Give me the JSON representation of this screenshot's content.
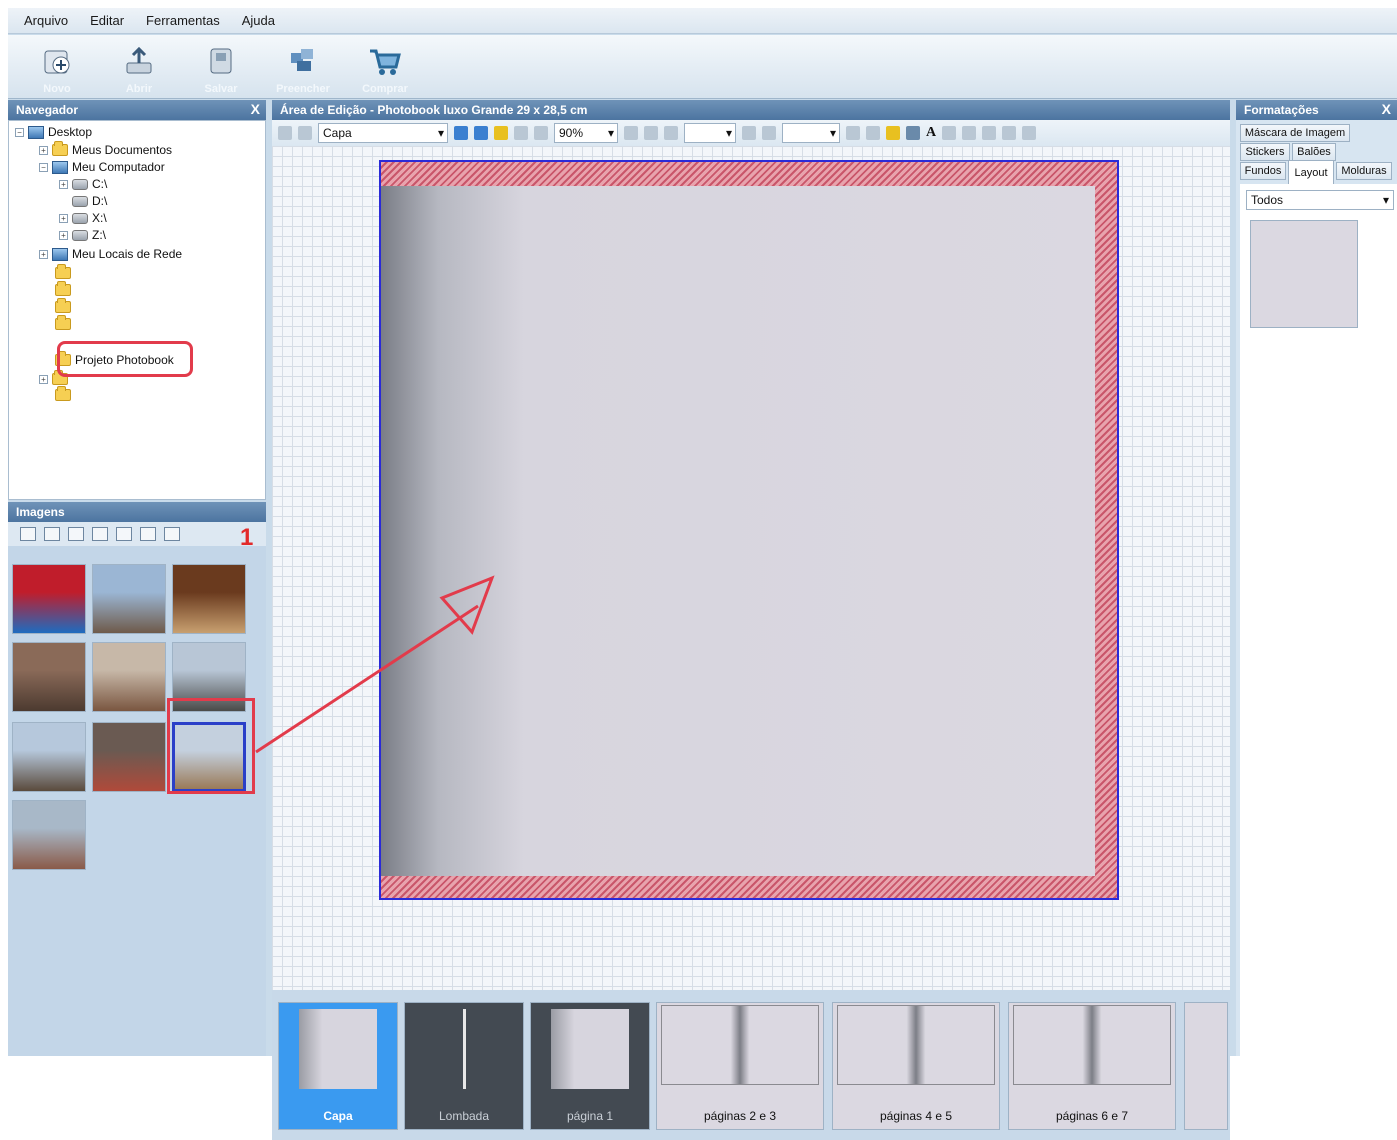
{
  "menu": [
    "Arquivo",
    "Editar",
    "Ferramentas",
    "Ajuda"
  ],
  "toolbar": [
    {
      "label": "Novo",
      "icon": "new-project-icon"
    },
    {
      "label": "Abrir",
      "icon": "open-icon"
    },
    {
      "label": "Salvar",
      "icon": "save-icon"
    },
    {
      "label": "Preencher",
      "icon": "fill-icon"
    },
    {
      "label": "Comprar",
      "icon": "cart-icon"
    }
  ],
  "navigator": {
    "title": "Navegador",
    "close": "X",
    "tree": {
      "desktop": "Desktop",
      "documents": "Meus Documentos",
      "computer": "Meu Computador",
      "drive_c": "C:\\",
      "drive_d": "D:\\",
      "drive_x": "X:\\",
      "drive_z": "Z:\\",
      "network": "Meu Locais de Rede",
      "project": "Projeto Photobook"
    }
  },
  "images": {
    "title": "Imagens",
    "callout_number": "1",
    "thumbs": [
      {
        "id": "t1",
        "colors": [
          "#c01d2b",
          "#1e6cc0"
        ]
      },
      {
        "id": "t2",
        "colors": [
          "#9bb6d4",
          "#6e5a4a"
        ]
      },
      {
        "id": "t3",
        "colors": [
          "#6a3a1e",
          "#c8a070"
        ]
      },
      {
        "id": "t4",
        "colors": [
          "#8a6a58",
          "#4c3a30"
        ]
      },
      {
        "id": "t5",
        "colors": [
          "#c7b8a8",
          "#7a5640"
        ]
      },
      {
        "id": "t6",
        "colors": [
          "#b8c6d6",
          "#4a4a48"
        ]
      },
      {
        "id": "t7",
        "colors": [
          "#b6c8dc",
          "#5a4a3c"
        ]
      },
      {
        "id": "t8",
        "colors": [
          "#6a5a52",
          "#b04a3a"
        ]
      },
      {
        "id": "t9",
        "colors": [
          "#c4d0de",
          "#9a7a58"
        ]
      },
      {
        "id": "t10",
        "colors": [
          "#a8b8c8",
          "#8a5a48"
        ]
      }
    ]
  },
  "editor": {
    "title": "Área de Edição - Photobook luxo Grande 29 x 28,5 cm",
    "page_select": "Capa",
    "zoom": "90%",
    "pages": [
      {
        "label": "Capa",
        "active": true
      },
      {
        "label": "Lombada",
        "active": false
      },
      {
        "label": "página 1",
        "active": false
      },
      {
        "label": "páginas 2 e 3",
        "active": false
      },
      {
        "label": "páginas 4 e 5",
        "active": false
      },
      {
        "label": "páginas 6 e 7",
        "active": false
      }
    ]
  },
  "formatting": {
    "title": "Formatações",
    "close": "X",
    "tabs": [
      "Máscara de Imagem",
      "Stickers",
      "Balões",
      "Fundos",
      "Layout",
      "Molduras"
    ],
    "active_tab": "Layout",
    "filter": "Todos"
  },
  "colors": {
    "accent": "#3a9af0",
    "highlight_red": "#e23b4b",
    "page_border": "#2a2ad8"
  }
}
